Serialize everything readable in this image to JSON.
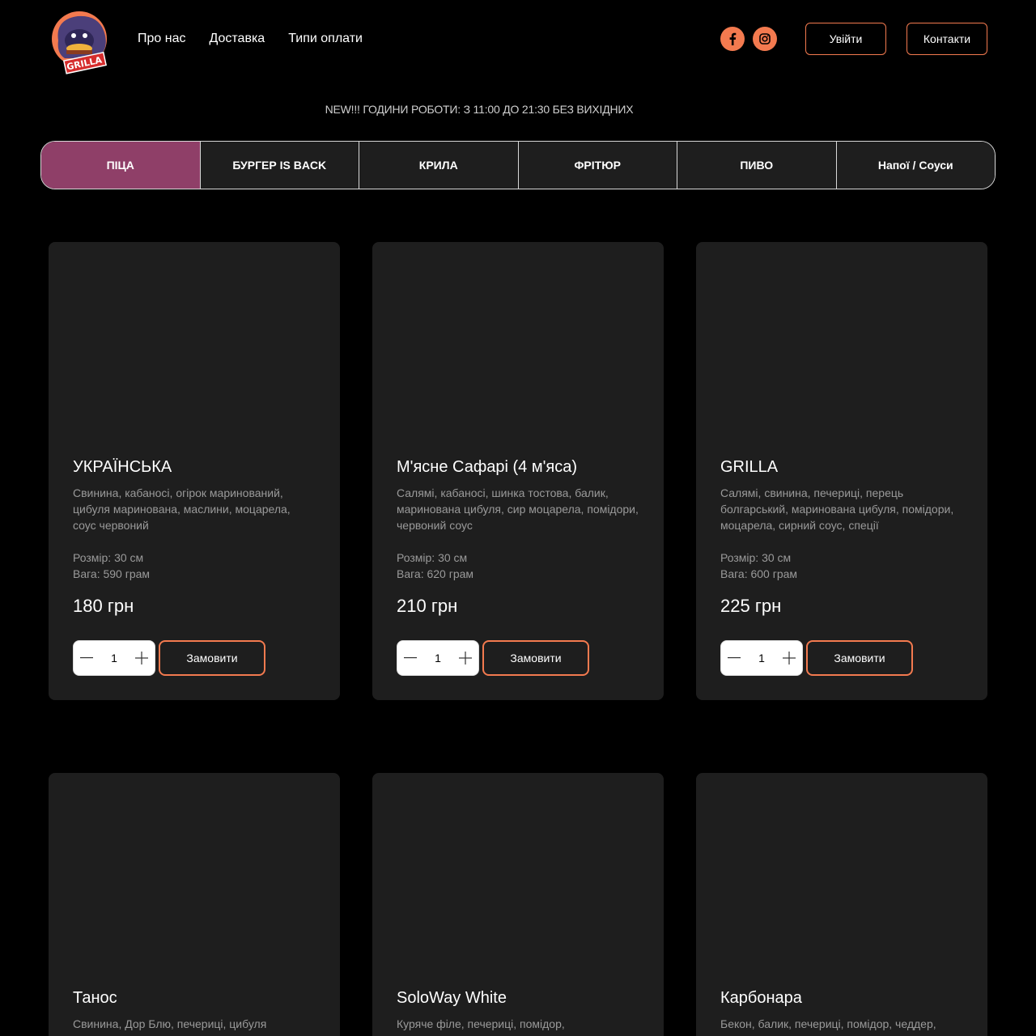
{
  "brand": {
    "logo_text": "GRILLA",
    "accent_color": "#f37a4f",
    "active_tab_color": "#8f3f68"
  },
  "nav": {
    "items": [
      "Про нас",
      "Доставка",
      "Типи оплати"
    ]
  },
  "socials": [
    {
      "icon": "facebook-icon"
    },
    {
      "icon": "instagram-icon"
    }
  ],
  "header": {
    "login_label": "Увійти",
    "contacts_label": "Контакти"
  },
  "announcement": "NEW!!! ГОДИНИ РОБОТИ: З 11:00 ДО 21:30 БЕЗ ВИХІДНИХ",
  "tabs": [
    "ПІЦА",
    "БУРГЕР IS BACK",
    "КРИЛА",
    "ФРІТЮР",
    "ПИВО",
    "Напої / Соуси"
  ],
  "active_tab": 0,
  "products": [
    {
      "title": "УКРАЇНСЬКА",
      "description": "Свинина, кабаносі, огірок маринований, цибуля маринована, маслини, моцарела, соус червоний",
      "size": "Розмір: 30 см",
      "weight": "Вага: 590 грам",
      "price": "180 грн",
      "qty": "1",
      "order_label": "Замовити"
    },
    {
      "title": "М'ясне Сафарі (4 м'яса)",
      "description": "Салямі, кабаносі, шинка тостова, балик, маринована цибуля, сир моцарела, помідори, червоний соус",
      "size": "Розмір: 30 см",
      "weight": "Вага: 620 грам",
      "price": "210 грн",
      "qty": "1",
      "order_label": "Замовити"
    },
    {
      "title": "GRILLA",
      "description": "Салямі, свинина, печериці, перець болгарський, маринована цибуля, помідори, моцарела, сирний соус, спеції",
      "size": "Розмір: 30 см",
      "weight": "Вага: 600 грам",
      "price": "225 грн",
      "qty": "1",
      "order_label": "Замовити"
    },
    {
      "title": "Танос",
      "description": "Свинина, Дор Блю, печериці, цибуля"
    },
    {
      "title": "SoloWay White",
      "description": "Куряче філе, печериці, помідор,"
    },
    {
      "title": "Карбонара",
      "description": "Бекон, балик, печериці, помідор, чеддер,"
    }
  ]
}
